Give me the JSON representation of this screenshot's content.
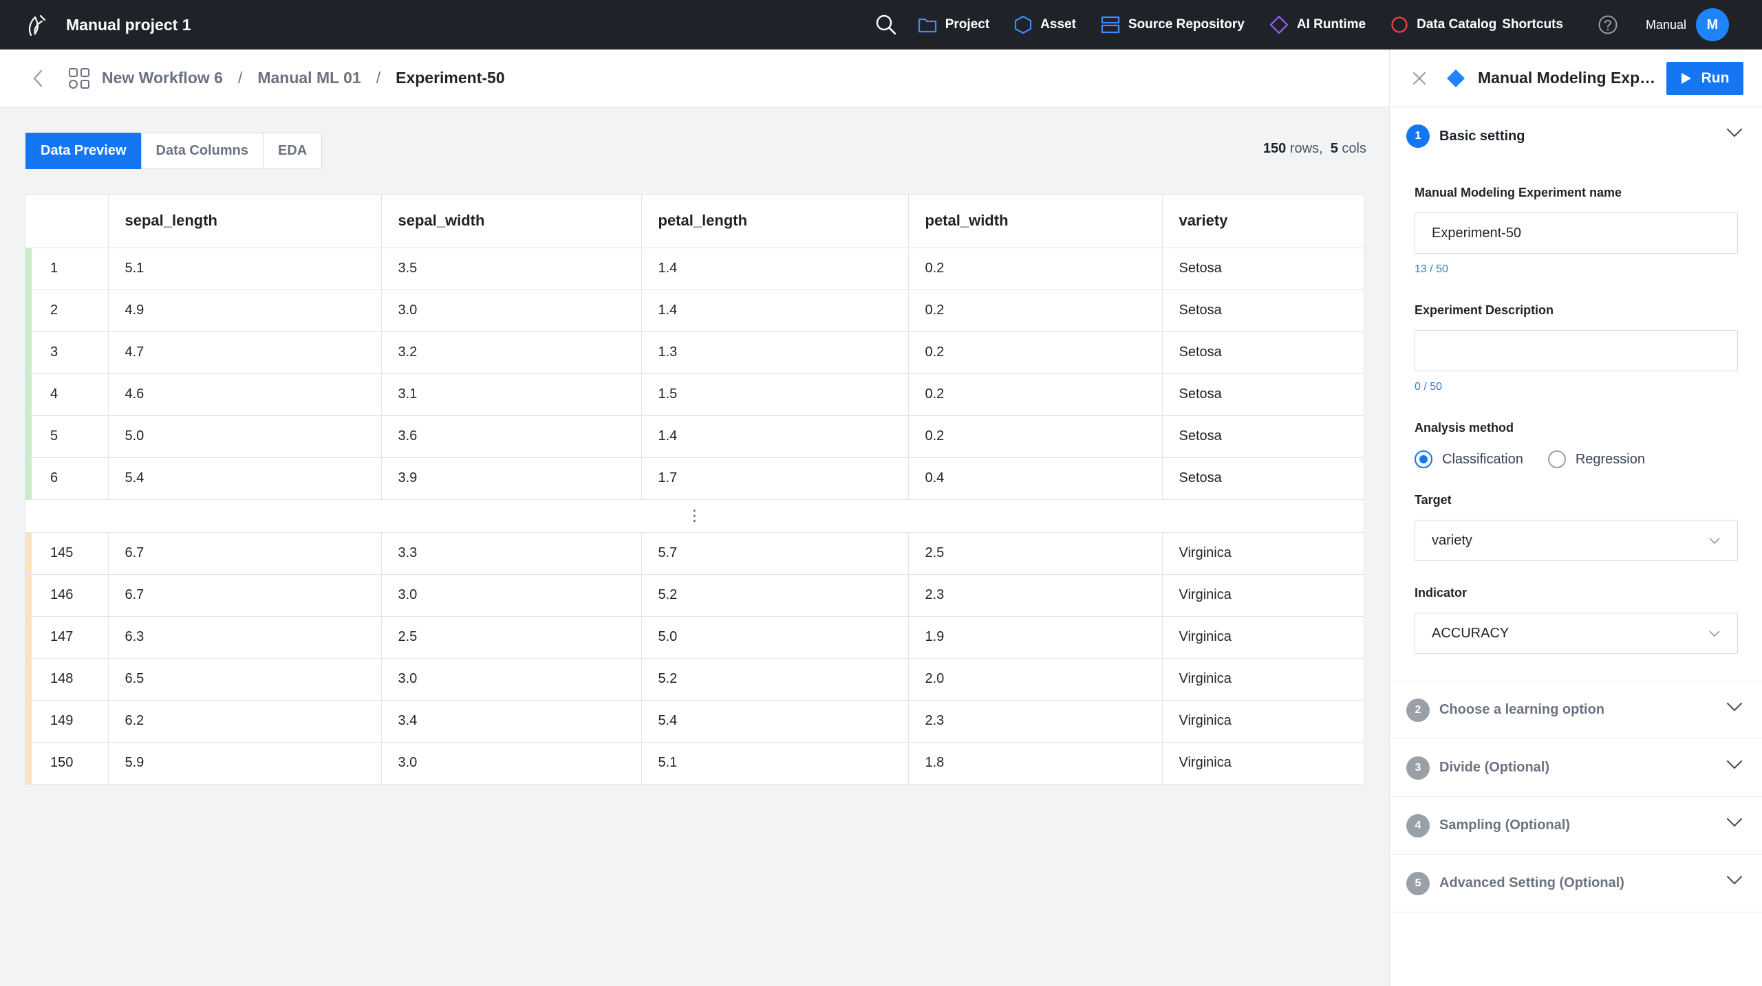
{
  "app": {
    "project_title": "Manual project 1",
    "nav": [
      {
        "label": "Project",
        "icon": "folder-icon"
      },
      {
        "label": "Asset",
        "icon": "hexagon-icon"
      },
      {
        "label": "Source Repository",
        "icon": "repository-icon"
      },
      {
        "label": "AI Runtime",
        "icon": "diamond-icon"
      },
      {
        "label": "Data Catalog",
        "icon": "catalog-icon"
      }
    ],
    "shortcuts_label": "Shortcuts",
    "user_name": "Manual",
    "avatar_initial": "M"
  },
  "breadcrumb": {
    "items": [
      "New Workflow 6",
      "Manual ML 01",
      "Experiment-50"
    ],
    "separator": "/"
  },
  "tabs": [
    "Data Preview",
    "Data Columns",
    "EDA"
  ],
  "summary": {
    "rows": "150",
    "rows_label": "rows,",
    "cols": "5",
    "cols_label": "cols"
  },
  "table": {
    "headers": [
      "",
      "sepal_length",
      "sepal_width",
      "petal_length",
      "petal_width",
      "variety"
    ],
    "top_rows": [
      [
        "1",
        "5.1",
        "3.5",
        "1.4",
        "0.2",
        "Setosa"
      ],
      [
        "2",
        "4.9",
        "3.0",
        "1.4",
        "0.2",
        "Setosa"
      ],
      [
        "3",
        "4.7",
        "3.2",
        "1.3",
        "0.2",
        "Setosa"
      ],
      [
        "4",
        "4.6",
        "3.1",
        "1.5",
        "0.2",
        "Setosa"
      ],
      [
        "5",
        "5.0",
        "3.6",
        "1.4",
        "0.2",
        "Setosa"
      ],
      [
        "6",
        "5.4",
        "3.9",
        "1.7",
        "0.4",
        "Setosa"
      ]
    ],
    "ellipsis": "⋮",
    "bottom_rows": [
      [
        "145",
        "6.7",
        "3.3",
        "5.7",
        "2.5",
        "Virginica"
      ],
      [
        "146",
        "6.7",
        "3.0",
        "5.2",
        "2.3",
        "Virginica"
      ],
      [
        "147",
        "6.3",
        "2.5",
        "5.0",
        "1.9",
        "Virginica"
      ],
      [
        "148",
        "6.5",
        "3.0",
        "5.2",
        "2.0",
        "Virginica"
      ],
      [
        "149",
        "6.2",
        "3.4",
        "5.4",
        "2.3",
        "Virginica"
      ],
      [
        "150",
        "5.9",
        "3.0",
        "5.1",
        "1.8",
        "Virginica"
      ]
    ]
  },
  "panel": {
    "title": "Manual Modeling Experiment",
    "run_label": "Run",
    "sections": [
      {
        "num": "1",
        "title": "Basic setting"
      },
      {
        "num": "2",
        "title": "Choose a learning option"
      },
      {
        "num": "3",
        "title": "Divide (Optional)"
      },
      {
        "num": "4",
        "title": "Sampling (Optional)"
      },
      {
        "num": "5",
        "title": "Advanced Setting (Optional)"
      }
    ],
    "form": {
      "name_label": "Manual Modeling Experiment name",
      "name_value": "Experiment-50",
      "name_count": "13 / 50",
      "desc_label": "Experiment Description",
      "desc_value": "",
      "desc_count": "0 / 50",
      "method_label": "Analysis method",
      "method_options": [
        "Classification",
        "Regression"
      ],
      "method_selected": "Classification",
      "target_label": "Target",
      "target_value": "variety",
      "indicator_label": "Indicator",
      "indicator_value": "ACCURACY"
    }
  },
  "colors": {
    "accent": "#1476f2",
    "topbar": "#1f2329",
    "setosa_marker": "#c9edc9",
    "virginica_marker": "#fde2c0",
    "avatar": "#1f84ff"
  }
}
